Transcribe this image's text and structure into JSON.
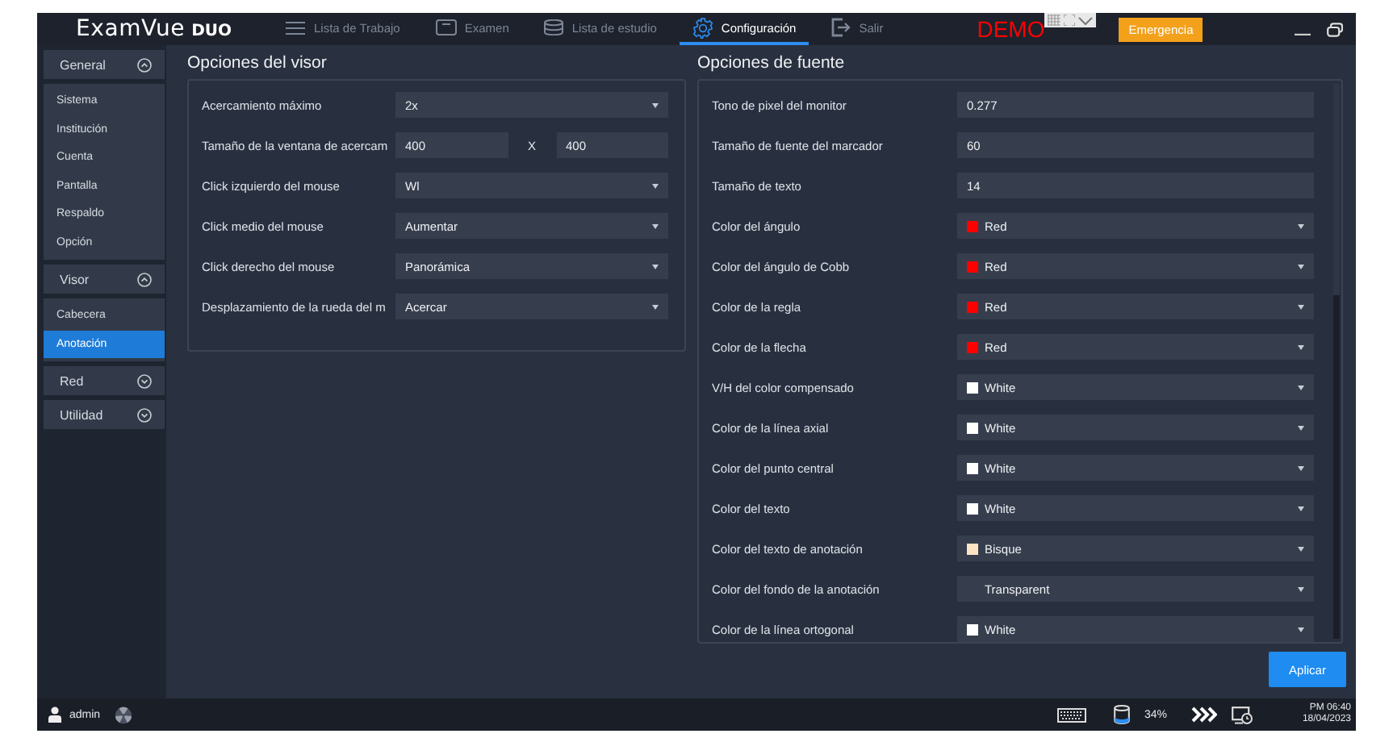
{
  "app": {
    "logo": "ExamVue",
    "logo_suffix": "DUO"
  },
  "nav": [
    {
      "label": "Lista de Trabajo",
      "selected": false
    },
    {
      "label": "Examen",
      "selected": false
    },
    {
      "label": "Lista de estudio",
      "selected": false
    },
    {
      "label": "Configuración",
      "selected": true
    },
    {
      "label": "Salir",
      "selected": false
    }
  ],
  "demo_label": "DEMO",
  "emergency_button": "Emergencia",
  "sidebar": [
    {
      "label": "General",
      "expanded": true,
      "items": [
        {
          "label": "Sistema",
          "selected": false
        },
        {
          "label": "Institución",
          "selected": false
        },
        {
          "label": "Cuenta",
          "selected": false
        },
        {
          "label": "Pantalla",
          "selected": false
        },
        {
          "label": "Respaldo",
          "selected": false
        },
        {
          "label": "Opción",
          "selected": false
        }
      ]
    },
    {
      "label": "Visor",
      "expanded": true,
      "items": [
        {
          "label": "Cabecera",
          "selected": false
        },
        {
          "label": "Anotación",
          "selected": true
        }
      ]
    },
    {
      "label": "Red",
      "expanded": false
    },
    {
      "label": "Utilidad",
      "expanded": false
    }
  ],
  "viewer_panel": {
    "title": "Opciones del visor",
    "rows": [
      {
        "label": "Acercamiento máximo",
        "kind": "select",
        "value": "2x"
      },
      {
        "label": "Tamaño de la ventana de acercam",
        "kind": "pair",
        "value": "400",
        "separator": "X",
        "value2": "400"
      },
      {
        "label": "Click izquierdo del mouse",
        "kind": "select",
        "value": "Wl"
      },
      {
        "label": "Click medio del mouse",
        "kind": "select",
        "value": "Aumentar"
      },
      {
        "label": "Click derecho del mouse",
        "kind": "select",
        "value": "Panorámica"
      },
      {
        "label": "Desplazamiento de la rueda del m",
        "kind": "select",
        "value": "Acercar"
      }
    ]
  },
  "font_panel": {
    "title": "Opciones de fuente",
    "rows": [
      {
        "label": "Tono de pixel del monitor",
        "kind": "text",
        "value": "0.277"
      },
      {
        "label": "Tamaño de fuente del marcador",
        "kind": "text",
        "value": "60"
      },
      {
        "label": "Tamaño de texto",
        "kind": "text",
        "value": "14"
      },
      {
        "label": "Color del ángulo",
        "kind": "color",
        "value": "Red",
        "color": "#ff0000"
      },
      {
        "label": "Color del ángulo de Cobb",
        "kind": "color",
        "value": "Red",
        "color": "#ff0000"
      },
      {
        "label": "Color de la regla",
        "kind": "color",
        "value": "Red",
        "color": "#ff0000"
      },
      {
        "label": "Color de la flecha",
        "kind": "color",
        "value": "Red",
        "color": "#ff0000"
      },
      {
        "label": "V/H del color compensado",
        "kind": "color",
        "value": "White",
        "color": "#ffffff"
      },
      {
        "label": "Color de la línea axial",
        "kind": "color",
        "value": "White",
        "color": "#ffffff"
      },
      {
        "label": "Color del punto central",
        "kind": "color",
        "value": "White",
        "color": "#ffffff"
      },
      {
        "label": "Color del texto",
        "kind": "color",
        "value": "White",
        "color": "#ffffff"
      },
      {
        "label": "Color del texto de anotación",
        "kind": "color",
        "value": "Bisque",
        "color": "#ffe4c4"
      },
      {
        "label": "Color del fondo de la anotación",
        "kind": "select",
        "value": "Transparent"
      },
      {
        "label": "Color de la línea ortogonal",
        "kind": "color",
        "value": "White",
        "color": "#ffffff"
      }
    ]
  },
  "apply_button": "Aplicar",
  "status_bar": {
    "user": "admin",
    "storage": "34%",
    "time": "PM 06:40",
    "date": "18/04/2023"
  }
}
